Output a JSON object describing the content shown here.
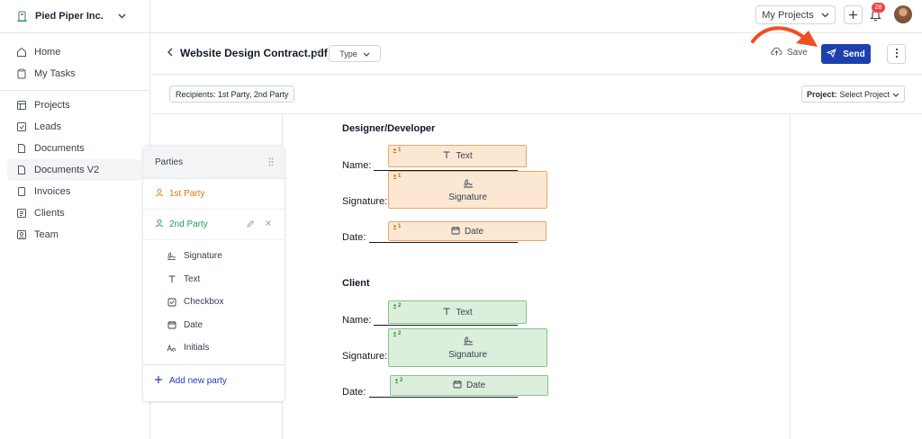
{
  "brand": {
    "name": "Pied Piper Inc.",
    "accent": "#16a34a"
  },
  "nav": {
    "primary": [
      {
        "label": "Home",
        "icon": "home-icon"
      },
      {
        "label": "My Tasks",
        "icon": "clipboard-icon"
      }
    ],
    "secondary": [
      {
        "label": "Projects",
        "icon": "projects-icon"
      },
      {
        "label": "Leads",
        "icon": "leads-icon"
      },
      {
        "label": "Documents",
        "icon": "document-icon"
      },
      {
        "label": "Documents V2",
        "icon": "document-icon",
        "active": true
      },
      {
        "label": "Invoices",
        "icon": "invoice-icon"
      },
      {
        "label": "Clients",
        "icon": "clients-icon"
      },
      {
        "label": "Team",
        "icon": "team-icon"
      }
    ]
  },
  "topbar": {
    "projects_label": "My Projects",
    "notification_count": "28"
  },
  "header": {
    "title": "Website Design Contract.pdf",
    "type_label": "Type",
    "save_label": "Save",
    "send_label": "Send",
    "send_color": "#1e40af",
    "annotation_arrow_color": "#f04e23"
  },
  "subbar": {
    "recipients": "Recipients: 1st Party, 2nd Party",
    "project_label": "Project:",
    "project_value": "Select Project"
  },
  "parties_panel": {
    "title": "Parties",
    "parties": [
      {
        "label": "1st Party",
        "color": "#d97706"
      },
      {
        "label": "2nd Party",
        "color": "#16a34a"
      }
    ],
    "fields": [
      {
        "label": "Signature",
        "icon": "signature-icon"
      },
      {
        "label": "Text",
        "icon": "text-icon"
      },
      {
        "label": "Checkbox",
        "icon": "checkbox-icon"
      },
      {
        "label": "Date",
        "icon": "calendar-icon"
      },
      {
        "label": "Initials",
        "icon": "initials-icon"
      }
    ],
    "add_label": "Add new party"
  },
  "document": {
    "sections": [
      {
        "title": "Designer/Developer",
        "party_tag": "1",
        "rows": [
          {
            "label": "Name:",
            "field": "Text"
          },
          {
            "label": "Signature:",
            "field": "Signature"
          },
          {
            "label": "Date:",
            "field": "Date"
          }
        ]
      },
      {
        "title": "Client",
        "party_tag": "2",
        "rows": [
          {
            "label": "Name:",
            "field": "Text"
          },
          {
            "label": "Signature:",
            "field": "Signature"
          },
          {
            "label": "Date:",
            "field": "Date"
          }
        ]
      }
    ]
  }
}
